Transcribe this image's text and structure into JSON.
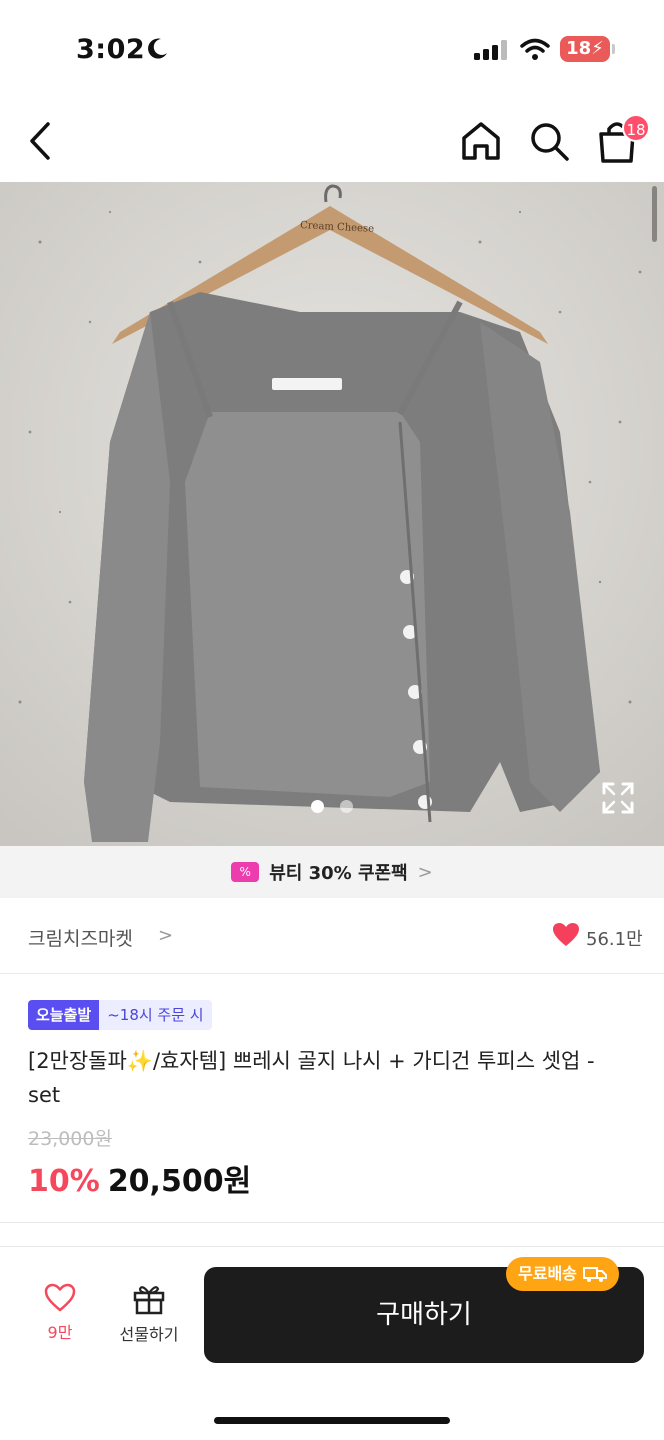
{
  "status_bar": {
    "time": "3:02",
    "battery": "18"
  },
  "nav": {
    "cart_count": "18"
  },
  "gallery": {
    "current_index": 1,
    "total": 2
  },
  "hanger_brand": "Cream Cheese",
  "coupon": {
    "icon_text": "%",
    "text": "뷰티 30% 쿠폰팩",
    "chevron": ">"
  },
  "store": {
    "name": "크림치즈마켓",
    "chevron": ">",
    "like_count": "56.1만"
  },
  "product": {
    "badge_today": "오늘출발",
    "badge_time": "~18시 주문 시",
    "title": "[2만장돌파✨/효자템] 쁘레시 골지 나시 + 가디건 투피스 셋업 - set",
    "original_price": "23,000원",
    "discount_rate": "10%",
    "sale_price": "20,500원"
  },
  "bottom_bar": {
    "wishlist_count": "9만",
    "gift_label": "선물하기",
    "buy_label": "구매하기",
    "free_shipping": "무료배송"
  },
  "colors": {
    "accent": "#f6485c",
    "badge_purple": "#5a4ef0",
    "shipping_orange": "#ffa412",
    "buy_dark": "#1c1c1c"
  }
}
